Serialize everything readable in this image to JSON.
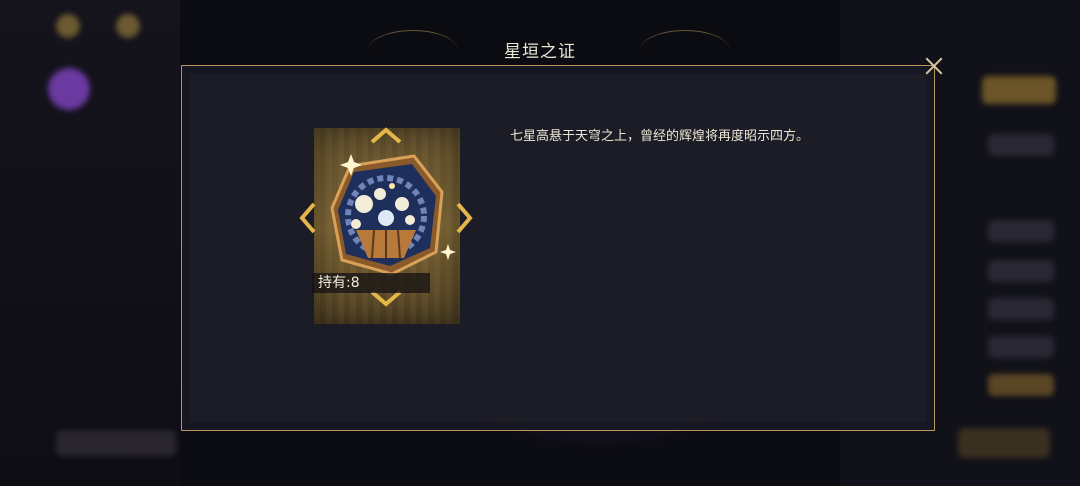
{
  "dialog": {
    "title": "星垣之证",
    "close_icon": "close-icon"
  },
  "item": {
    "name_icon": "star-altar-medal-icon",
    "held_label": "持有:8",
    "description": "七星高悬于天穹之上，曾经的辉煌将再度昭示四方。"
  },
  "colors": {
    "frame_gold": "#b8955a",
    "panel_bg": "#1c1c27",
    "text_light": "#ece6d4",
    "medal_blue": "#1f2f5c",
    "medal_bronze": "#a8743a"
  }
}
